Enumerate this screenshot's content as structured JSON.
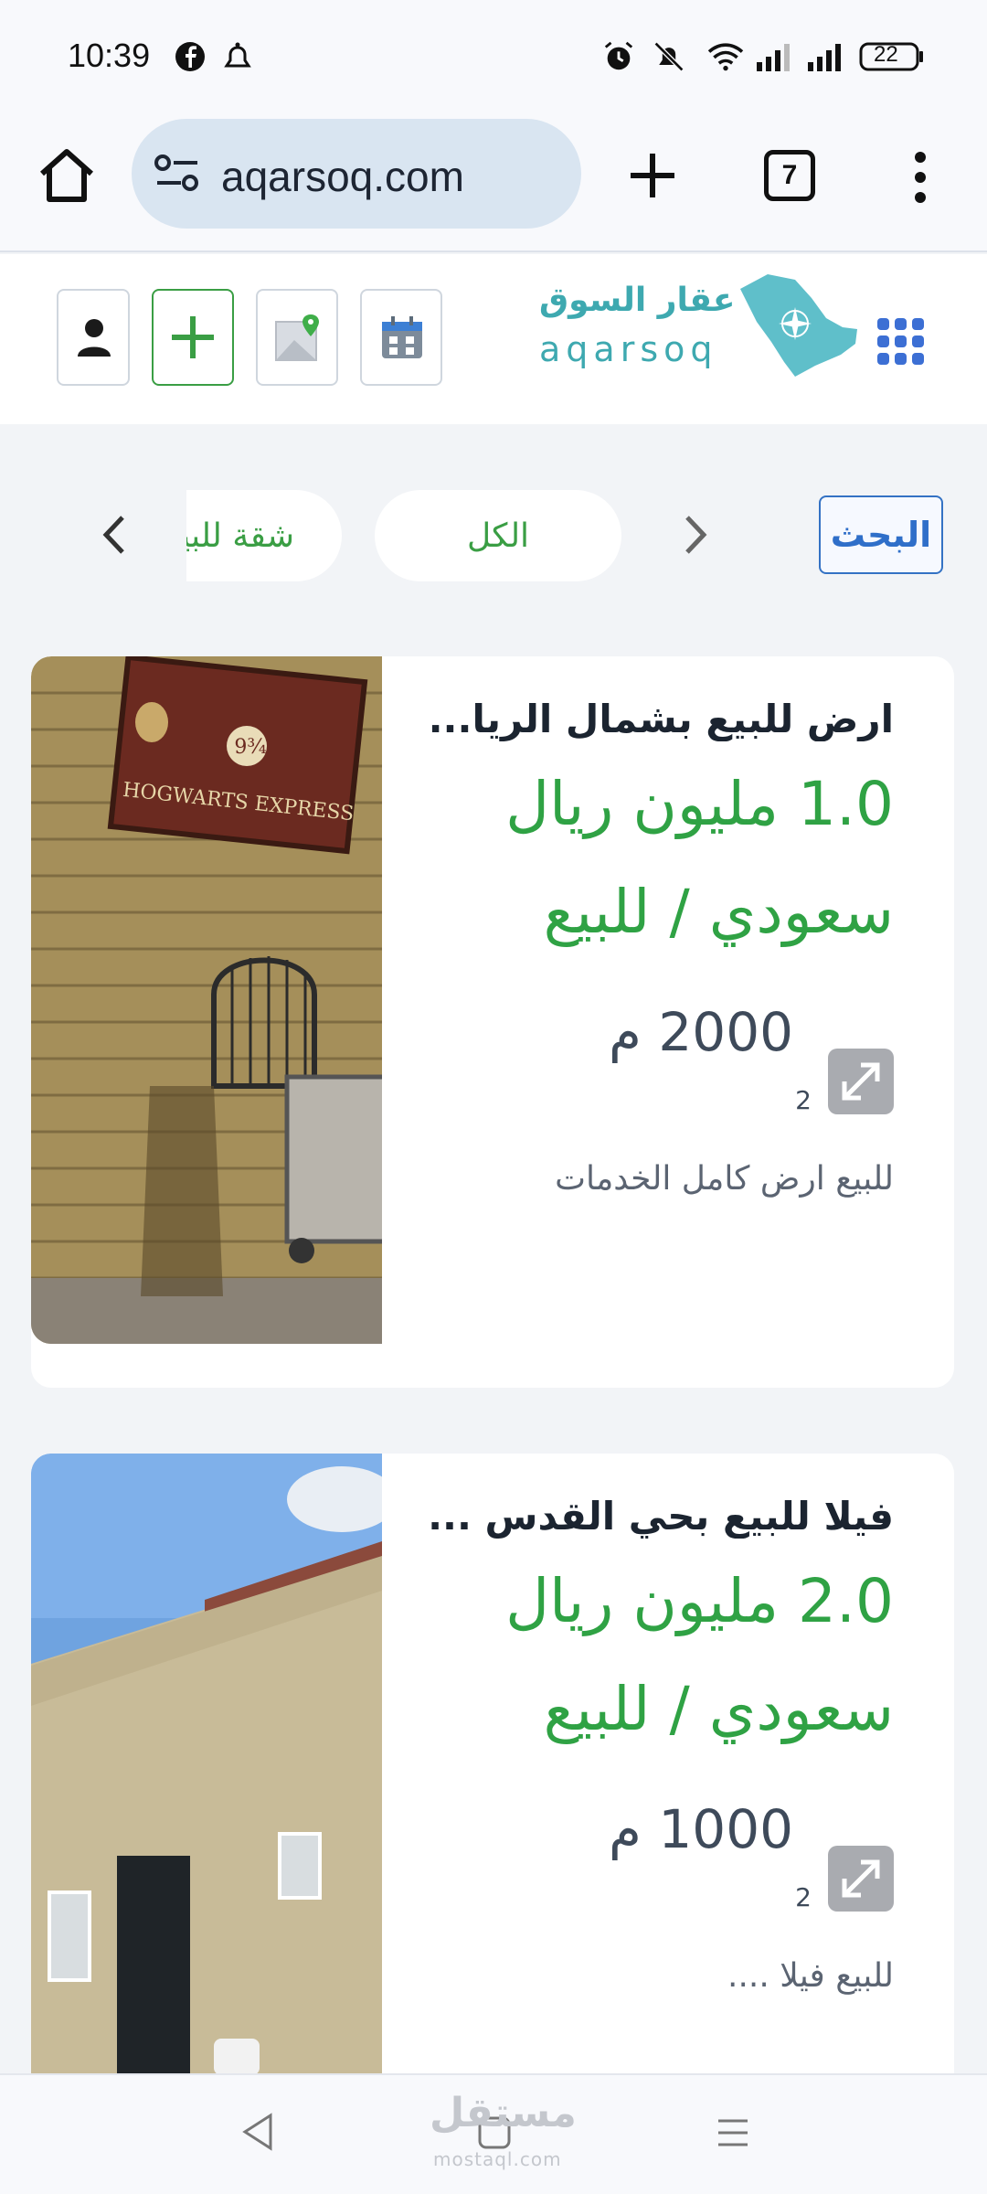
{
  "status_bar": {
    "time": "10:39",
    "battery": "22"
  },
  "browser": {
    "url": "aqarsoq.com",
    "tab_count": "7"
  },
  "site_header": {
    "logo_arabic": "عقار السوق",
    "logo_latin": "aqarsoq"
  },
  "filters": {
    "search_label": "البحث",
    "all_label": "الكل",
    "apartment_label": "شقة للبيع"
  },
  "listings": [
    {
      "title": "ارض للبيع بشمال الريا...",
      "price": "1.0 مليون ريال سعودي / للبيع",
      "area": "2000 م",
      "area_unit_sup": "2",
      "description": "للبيع ارض كامل الخدمات"
    },
    {
      "title": "فيلا للبيع بحي القدس ...",
      "price": "2.0 مليون ريال سعودي / للبيع",
      "area": "1000 م",
      "area_unit_sup": "2",
      "description": "للبيع فيلا ...."
    }
  ],
  "watermark": {
    "arabic": "مستقل",
    "latin": "mostaql.com"
  },
  "colors": {
    "accent_green": "#2fa244",
    "brand_teal": "#3ea9b0",
    "link_blue": "#2f6fc9"
  }
}
